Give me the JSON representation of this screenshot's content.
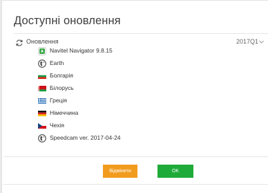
{
  "dialog": {
    "title": "Доступні оновлення"
  },
  "updates": {
    "label": "Оновлення",
    "version": "2017Q1"
  },
  "items": [
    {
      "label": "Navitel Navigator 9.8.15",
      "icon": "navitel-app-icon"
    },
    {
      "label": "Earth",
      "icon": "globe-icon"
    },
    {
      "label": "Болгарія",
      "icon": "flag-bulgaria-icon"
    },
    {
      "label": "Білорусь",
      "icon": "flag-belarus-icon"
    },
    {
      "label": "Греція",
      "icon": "flag-greece-icon"
    },
    {
      "label": "Німеччина",
      "icon": "flag-germany-icon"
    },
    {
      "label": "Чехія",
      "icon": "flag-czechia-icon"
    },
    {
      "label": "Speedcam ver. 2017-04-24",
      "icon": "speedcam-icon"
    }
  ],
  "buttons": {
    "cancel_label": "Відмінити",
    "ok_label": "OK"
  },
  "colors": {
    "cancel": "#f29c1f",
    "ok": "#1eab3a"
  }
}
